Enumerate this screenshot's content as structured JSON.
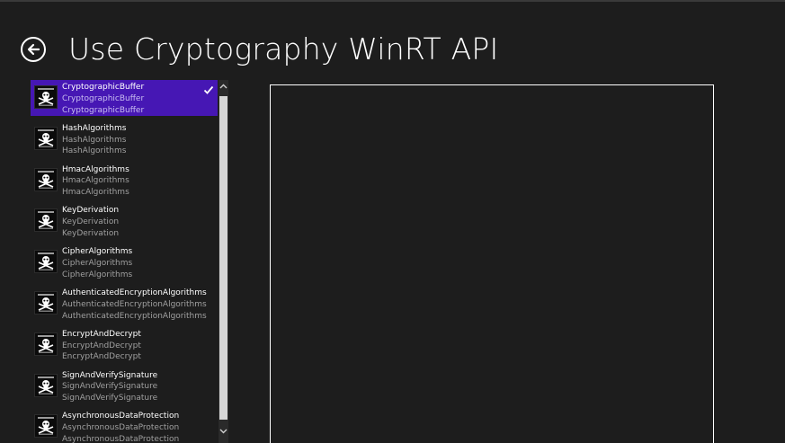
{
  "app": {
    "title": "Use Cryptography WinRT API"
  },
  "back": {
    "icon": "back-arrow-icon"
  },
  "list": {
    "items": [
      {
        "title": "CryptographicBuffer",
        "subtitle": "CryptographicBuffer",
        "description": "CryptographicBuffer",
        "selected": true,
        "icon": "skull-crossbones-thumbnail"
      },
      {
        "title": "HashAlgorithms",
        "subtitle": "HashAlgorithms",
        "description": "HashAlgorithms",
        "selected": false,
        "icon": "skull-crossbones-thumbnail"
      },
      {
        "title": "HmacAlgorithms",
        "subtitle": "HmacAlgorithms",
        "description": "HmacAlgorithms",
        "selected": false,
        "icon": "skull-crossbones-thumbnail"
      },
      {
        "title": "KeyDerivation",
        "subtitle": "KeyDerivation",
        "description": "KeyDerivation",
        "selected": false,
        "icon": "skull-crossbones-thumbnail"
      },
      {
        "title": "CipherAlgorithms",
        "subtitle": "CipherAlgorithms",
        "description": "CipherAlgorithms",
        "selected": false,
        "icon": "skull-crossbones-thumbnail"
      },
      {
        "title": "AuthenticatedEncryptionAlgorithms",
        "subtitle": "AuthenticatedEncryptionAlgorithms",
        "description": "AuthenticatedEncryptionAlgorithms",
        "selected": false,
        "icon": "skull-crossbones-thumbnail"
      },
      {
        "title": "EncryptAndDecrypt",
        "subtitle": "EncryptAndDecrypt",
        "description": "EncryptAndDecrypt",
        "selected": false,
        "icon": "skull-crossbones-thumbnail"
      },
      {
        "title": "SignAndVerifySignature",
        "subtitle": "SignAndVerifySignature",
        "description": "SignAndVerifySignature",
        "selected": false,
        "icon": "skull-crossbones-thumbnail"
      },
      {
        "title": "AsynchronousDataProtection",
        "subtitle": "AsynchronousDataProtection",
        "description": "AsynchronousDataProtection",
        "selected": false,
        "icon": "skull-crossbones-thumbnail"
      }
    ]
  },
  "scrollbar": {
    "up_icon": "chevron-up-icon",
    "down_icon": "chevron-down-icon"
  },
  "colors": {
    "background": "#1d1d1d",
    "accent": "#4617b4",
    "text": "#ffffff",
    "secondary_text": "#a0a0a0"
  }
}
